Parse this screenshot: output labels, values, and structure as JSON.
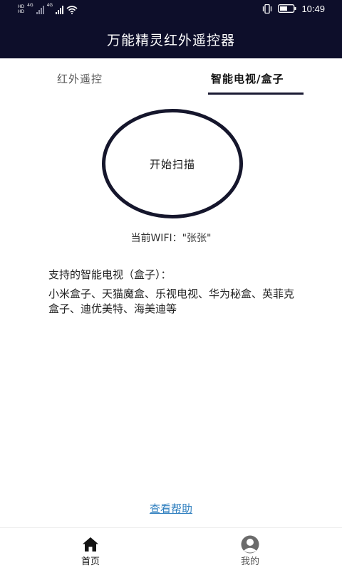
{
  "status_bar": {
    "sim1_tag": "HD",
    "sim2_tag": "HD",
    "network1": "4G",
    "network2": "4G",
    "time": "10:49",
    "icons": [
      "signal-icon",
      "wifi-icon",
      "vibrate-icon",
      "battery-icon"
    ]
  },
  "header": {
    "title": "万能精灵红外遥控器"
  },
  "tabs": {
    "infrared": "红外遥控",
    "smart_tv": "智能电视/盒子",
    "active": "smart_tv"
  },
  "scan": {
    "button_label": "开始扫描"
  },
  "wifi": {
    "text": "当前WIFI：\"张张\""
  },
  "support": {
    "title": "支持的智能电视（盒子）：",
    "list": "小米盒子、天猫魔盒、乐视电视、华为秘盒、英菲克盒子、迪优美特、海美迪等"
  },
  "help": {
    "link_label": "查看帮助"
  },
  "bottom_nav": {
    "home_label": "首页",
    "mine_label": "我的",
    "active": "home"
  },
  "colors": {
    "header_bg": "#0d0e2a",
    "link": "#2f7fbf",
    "scan_ring": "#15162c"
  }
}
